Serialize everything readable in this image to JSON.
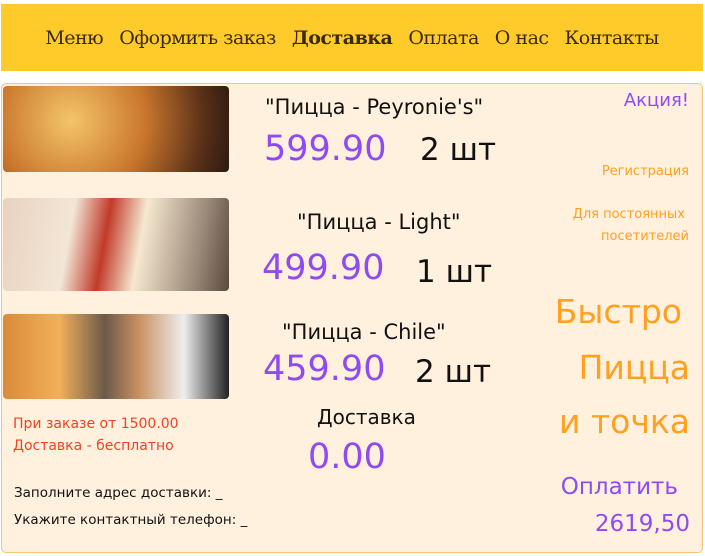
{
  "nav": [
    "Меню",
    "Оформить заказ",
    "Доставка",
    "Оплата",
    "О нас",
    "Контакты"
  ],
  "nav_active": 2,
  "items": [
    {
      "name": "\"Пицца - Peyronie's\"",
      "price": "599.90",
      "qty": "2 шт"
    },
    {
      "name": "\"Пицца - Light\"",
      "price": "499.90",
      "qty": "1 шт"
    },
    {
      "name": "\"Пицца - Chile\"",
      "price": "459.90",
      "qty": "2 шт"
    }
  ],
  "delivery": {
    "label": "Доставка",
    "price": "0.00"
  },
  "promo": {
    "title": "Акция!",
    "register": "Регистрация",
    "regular1": "Для постоянных",
    "regular2": "посетителей"
  },
  "slogan": [
    "Быстро",
    "Пицца",
    "и точка"
  ],
  "free": {
    "line1": "При заказе от 1500.00",
    "line2": "Доставка - бесплатно"
  },
  "form": {
    "address": "Заполните адрес доставки: _",
    "phone": "Укажите контактный телефон: _"
  },
  "pay": {
    "label": "Оплатить",
    "total": "2619,50"
  }
}
